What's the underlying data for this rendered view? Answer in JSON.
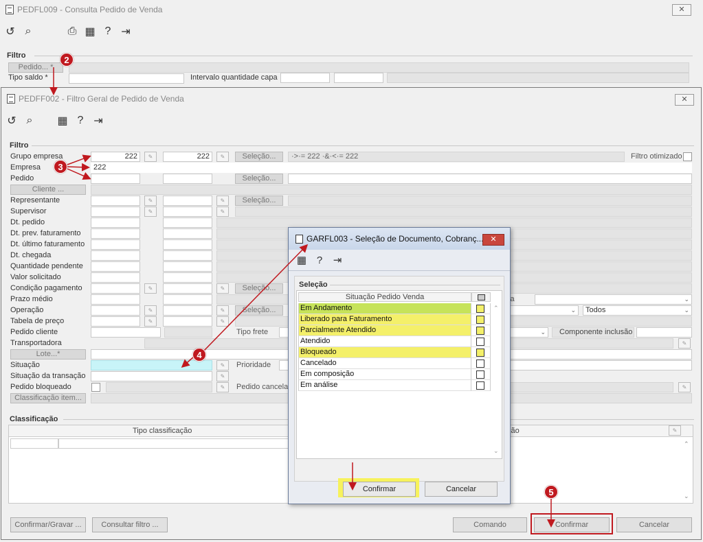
{
  "back_window": {
    "title": "PEDFL009 - Consulta Pedido de Venda",
    "close": "✕",
    "group_filtro": "Filtro",
    "pedido_btn": "Pedido... *",
    "tipo_saldo_label": "Tipo saldo *",
    "intervalo_label": "Intervalo quantidade capa"
  },
  "main_window": {
    "title": "PEDFF002 - Filtro Geral de Pedido de Venda",
    "close": "✕",
    "group_filtro": "Filtro",
    "filtro_otimizado": "Filtro otimizado",
    "grupo_empresa": {
      "label": "Grupo empresa",
      "from": "222",
      "to": "222",
      "selecao": "Seleção...",
      "expr": "·>·= 222 ·&·<·= 222"
    },
    "empresa": {
      "label": "Empresa",
      "value": "222"
    },
    "pedido": {
      "label": "Pedido",
      "selecao": "Seleção..."
    },
    "cliente_btn": "Cliente ...",
    "representante": {
      "label": "Representante",
      "selecao": "Seleção..."
    },
    "supervisor": "Supervisor",
    "dt_pedido": "Dt. pedido",
    "dt_prev_faturamento": "Dt. prev. faturamento",
    "dt_ultimo_faturamento": "Dt. último faturamento",
    "dt_chegada": "Dt. chegada",
    "quantidade_pendente": "Quantidade pendente",
    "valor_solicitado": "Valor solicitado",
    "condicao_pagamento": {
      "label": "Condição pagamento",
      "selecao": "Seleção..."
    },
    "prazo_medio": "Prazo médio",
    "operacao": {
      "label": "Operação",
      "selecao": "Seleção..."
    },
    "tabela_preco": "Tabela de preço",
    "pedido_cliente": "Pedido cliente",
    "transportadora": "Transportadora",
    "lote_btn": "Lote...*",
    "situacao": "Situação",
    "situacao_transacao": "Situação da transação",
    "pedido_bloqueado": "Pedido bloqueado",
    "classificacao_item_btn": "Classificação item...",
    "tipo_frete": "Tipo frete",
    "componente_inclusao": "Componente inclusão",
    "prioridade": "Prioridade",
    "pedido_cancelado": "Pedido cancelad",
    "todos": "Todos",
    "sa_partial": "sa",
    "group_classificacao": "Classificação",
    "col_tipo_classificacao": "Tipo classificação",
    "col_cao_partial": "ção",
    "buttons": {
      "confirmar_gravar": "Confirmar/Gravar ...",
      "consultar_filtro": "Consultar filtro ...",
      "comando": "Comando",
      "confirmar": "Confirmar",
      "cancelar": "Cancelar"
    }
  },
  "dialog": {
    "title": "GARFL003 - Seleção de Documento, Cobranç...",
    "close": "✕",
    "group": "Seleção",
    "column_header": "Situação Pedido Venda",
    "rows": [
      {
        "label": "Em Andamento",
        "highlight": "#c6e35a"
      },
      {
        "label": "Liberado para Faturamento",
        "highlight": "#f4f06a"
      },
      {
        "label": "Parcialmente Atendido",
        "highlight": "#f4f06a"
      },
      {
        "label": "Atendido",
        "highlight": ""
      },
      {
        "label": "Bloqueado",
        "highlight": "#f4f06a"
      },
      {
        "label": "Cancelado",
        "highlight": ""
      },
      {
        "label": "Em composição",
        "highlight": ""
      },
      {
        "label": "Em análise",
        "highlight": ""
      }
    ],
    "confirmar": "Confirmar",
    "cancelar": "Cancelar"
  },
  "markers": [
    "2",
    "3",
    "4",
    "5"
  ],
  "colors": {
    "marker": "#c0191f",
    "highlight_box": "#f7f25c",
    "situacao_field": "#c8f4f8"
  }
}
